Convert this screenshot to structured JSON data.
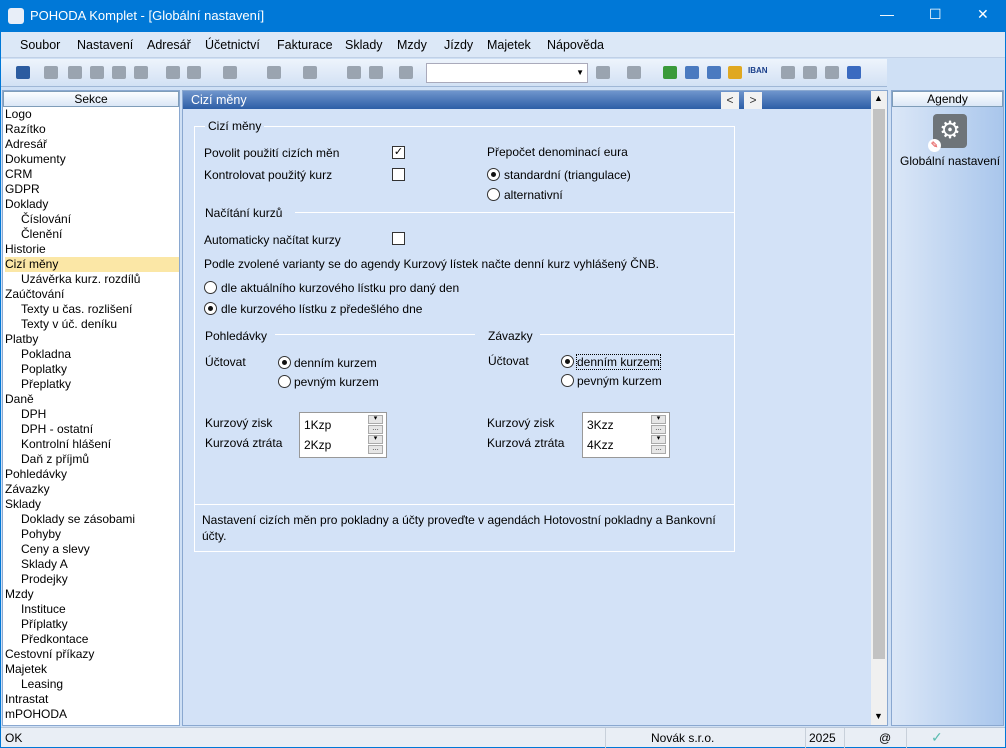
{
  "window": {
    "title": "POHODA Komplet - [Globální nastavení]",
    "minimize": "—",
    "maximize": "☐",
    "close": "✕"
  },
  "menu": [
    "Soubor",
    "Nastavení",
    "Adresář",
    "Účetnictví",
    "Fakturace",
    "Sklady",
    "Mzdy",
    "Jízdy",
    "Majetek",
    "Nápověda"
  ],
  "toolbar": {
    "iban": "IBAN"
  },
  "sidebar": {
    "title": "Sekce",
    "items": [
      {
        "label": "Logo",
        "indent": false
      },
      {
        "label": "Razítko",
        "indent": false
      },
      {
        "label": "Adresář",
        "indent": false
      },
      {
        "label": "Dokumenty",
        "indent": false
      },
      {
        "label": "CRM",
        "indent": false
      },
      {
        "label": "GDPR",
        "indent": false
      },
      {
        "label": "Doklady",
        "indent": false
      },
      {
        "label": "Číslování",
        "indent": true
      },
      {
        "label": "Členění",
        "indent": true
      },
      {
        "label": "Historie",
        "indent": false
      },
      {
        "label": "Cizí měny",
        "indent": false,
        "selected": true
      },
      {
        "label": "Uzávěrka kurz. rozdílů",
        "indent": true
      },
      {
        "label": "Zaúčtování",
        "indent": false
      },
      {
        "label": "Texty u čas. rozlišení",
        "indent": true
      },
      {
        "label": "Texty v úč. deníku",
        "indent": true
      },
      {
        "label": "Platby",
        "indent": false
      },
      {
        "label": "Pokladna",
        "indent": true
      },
      {
        "label": "Poplatky",
        "indent": true
      },
      {
        "label": "Přeplatky",
        "indent": true
      },
      {
        "label": "Daně",
        "indent": false
      },
      {
        "label": "DPH",
        "indent": true
      },
      {
        "label": "DPH - ostatní",
        "indent": true
      },
      {
        "label": "Kontrolní hlášení",
        "indent": true
      },
      {
        "label": "Daň z příjmů",
        "indent": true
      },
      {
        "label": "Pohledávky",
        "indent": false
      },
      {
        "label": "Závazky",
        "indent": false
      },
      {
        "label": "Sklady",
        "indent": false
      },
      {
        "label": "Doklady se zásobami",
        "indent": true
      },
      {
        "label": "Pohyby",
        "indent": true
      },
      {
        "label": "Ceny a slevy",
        "indent": true
      },
      {
        "label": "Sklady A",
        "indent": true
      },
      {
        "label": "Prodejky",
        "indent": true
      },
      {
        "label": "Mzdy",
        "indent": false
      },
      {
        "label": "Instituce",
        "indent": true
      },
      {
        "label": "Příplatky",
        "indent": true
      },
      {
        "label": "Předkontace",
        "indent": true
      },
      {
        "label": "Cestovní příkazy",
        "indent": false
      },
      {
        "label": "Majetek",
        "indent": false
      },
      {
        "label": "Leasing",
        "indent": true
      },
      {
        "label": "Intrastat",
        "indent": false
      },
      {
        "label": "mPOHODA",
        "indent": false
      }
    ]
  },
  "main": {
    "title": "Cizí měny",
    "prev": "<",
    "next": ">",
    "g1": "Cizí měny",
    "allow": "Povolit použití cizích měn",
    "allow_checked": true,
    "check": "Kontrolovat použitý kurz",
    "check_checked": false,
    "denom_title": "Přepočet denominací eura",
    "denom_std": "standardní  (triangulace)",
    "denom_alt": "alternativní",
    "g2": "Načítání kurzů",
    "auto": "Automaticky načítat kurzy",
    "auto_checked": false,
    "info": "Podle zvolené varianty se do agendy Kurzový lístek načte denní kurz vyhlášený ČNB.",
    "opt1": "dle aktuálního kurzového lístku pro daný den",
    "opt2": "dle kurzového lístku z předešlého dne",
    "pohl": "Pohledávky",
    "zav": "Závazky",
    "uctovat": "Účtovat",
    "denni": "denním kurzem",
    "pevny": "pevným kurzem",
    "zisk": "Kurzový zisk",
    "ztrata": "Kurzová ztráta",
    "pohl_zisk": "1Kzp",
    "pohl_ztrata": "2Kzp",
    "zav_zisk": "3Kzz",
    "zav_ztrata": "4Kzz",
    "note": "Nastavení cizích měn pro pokladny a účty proveďte v agendách Hotovostní pokladny a Bankovní účty."
  },
  "agendy": {
    "title": "Agendy",
    "item": "Globální nastavení"
  },
  "status": {
    "left": "OK",
    "company": "Novák s.r.o.",
    "year": "2025",
    "at": "@",
    "check": "✓"
  }
}
